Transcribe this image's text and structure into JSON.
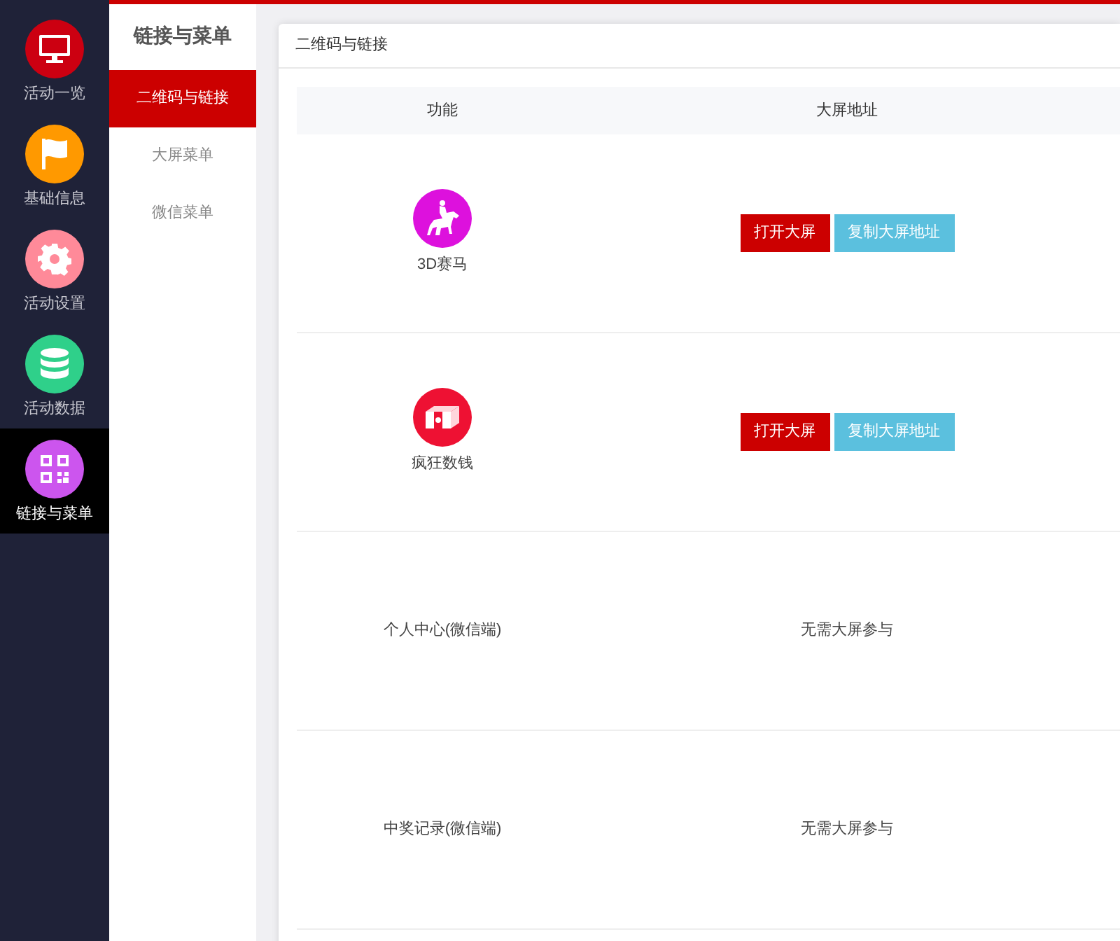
{
  "nav": [
    {
      "label": "活动一览",
      "kind": "monitor",
      "color": "#cc0011",
      "selected": false
    },
    {
      "label": "基础信息",
      "kind": "flag",
      "color": "#ff9900",
      "selected": false
    },
    {
      "label": "活动设置",
      "kind": "gear",
      "color": "#ff8a99",
      "selected": false
    },
    {
      "label": "活动数据",
      "kind": "database",
      "color": "#2fd08a",
      "selected": false
    },
    {
      "label": "链接与菜单",
      "kind": "qr",
      "color": "#cc55ee",
      "selected": true
    }
  ],
  "submenu": {
    "title": "链接与菜单",
    "items": [
      {
        "label": "二维码与链接",
        "selected": true
      },
      {
        "label": "大屏菜单",
        "selected": false
      },
      {
        "label": "微信菜单",
        "selected": false
      }
    ]
  },
  "panel": {
    "title": "二维码与链接",
    "table": {
      "columns": [
        "功能",
        "大屏地址"
      ],
      "rows": [
        {
          "kind": "horse",
          "color": "#dd11dd",
          "name": "3D赛马",
          "buttons": [
            "打开大屏",
            "复制大屏地址"
          ]
        },
        {
          "kind": "money",
          "color": "#ee1133",
          "name": "疯狂数钱",
          "buttons": [
            "打开大屏",
            "复制大屏地址"
          ]
        },
        {
          "kind": "text",
          "name": "个人中心(微信端)",
          "note": "无需大屏参与"
        },
        {
          "kind": "text",
          "name": "中奖记录(微信端)",
          "note": "无需大屏参与"
        }
      ]
    }
  }
}
